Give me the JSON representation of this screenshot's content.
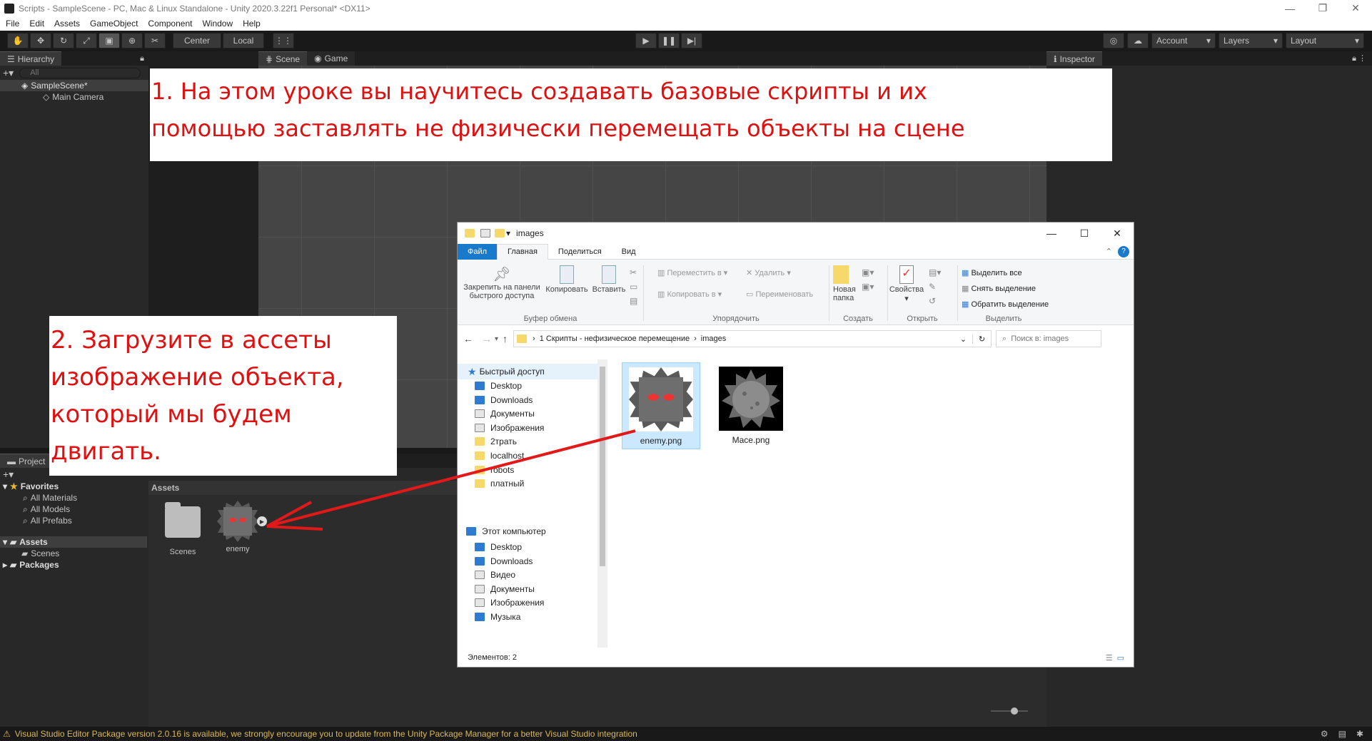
{
  "titlebar": {
    "title": "Scripts - SampleScene - PC, Mac & Linux Standalone - Unity 2020.3.22f1 Personal* <DX11>",
    "min": "—",
    "max": "❐",
    "close": "✕"
  },
  "menu": [
    "File",
    "Edit",
    "Assets",
    "GameObject",
    "Component",
    "Window",
    "Help"
  ],
  "toolbar": {
    "center": "Center",
    "local": "Local",
    "account": "Account",
    "layers": "Layers",
    "layout": "Layout"
  },
  "hierarchy": {
    "tab": "Hierarchy",
    "search_placeholder": "All",
    "scene": "SampleScene*",
    "camera": "Main Camera"
  },
  "scene_tabs": {
    "scene": "Scene",
    "game": "Game"
  },
  "inspector": {
    "tab": "Inspector"
  },
  "callout1": {
    "line1": "1. На этом уроке вы научитесь создавать базовые скрипты и их",
    "line2": "помощью заставлять не физически перемещать объекты на сцене"
  },
  "callout2": {
    "line1": "2. Загрузите в ассеты",
    "line2": "изображение объекта,",
    "line3": "который мы будем",
    "line4": "двигать."
  },
  "project": {
    "tab": "Project",
    "favorites": "Favorites",
    "fav_items": [
      "All Materials",
      "All Models",
      "All Prefabs"
    ],
    "assets": "Assets",
    "scenes": "Scenes",
    "packages": "Packages",
    "header": "Assets",
    "items": [
      {
        "label": "Scenes"
      },
      {
        "label": "enemy"
      }
    ]
  },
  "explorer": {
    "title": "images",
    "tabs": [
      "Файл",
      "Главная",
      "Поделиться",
      "Вид"
    ],
    "ribbon": {
      "pin": "Закрепить на панели быстрого доступа",
      "copy": "Копировать",
      "paste": "Вставить",
      "move_to": "Переместить в",
      "copy_to": "Копировать в",
      "delete": "Удалить",
      "rename": "Переименовать",
      "new_folder": "Новая папка",
      "properties": "Свойства",
      "select_all": "Выделить все",
      "select_none": "Снять выделение",
      "invert": "Обратить выделение",
      "groups": [
        "Буфер обмена",
        "Упорядочить",
        "Создать",
        "Открыть",
        "Выделить"
      ]
    },
    "path": [
      "1 Скрипты - нефизическое перемещение",
      "images"
    ],
    "search_placeholder": "Поиск в: images",
    "quick_access": "Быстрый доступ",
    "nav_quick": [
      {
        "label": "Desktop",
        "icon": "desktop-icon"
      },
      {
        "label": "Downloads",
        "icon": "download-icon"
      },
      {
        "label": "Документы",
        "icon": "documents-icon"
      },
      {
        "label": "Изображения",
        "icon": "pictures-icon"
      },
      {
        "label": "2трать",
        "icon": "folder-icon"
      },
      {
        "label": "localhost",
        "icon": "folder-icon"
      },
      {
        "label": "robots",
        "icon": "folder-icon"
      },
      {
        "label": "платный",
        "icon": "folder-icon"
      }
    ],
    "this_pc": "Этот компьютер",
    "nav_pc": [
      {
        "label": "Desktop",
        "icon": "desktop-icon"
      },
      {
        "label": "Downloads",
        "icon": "download-icon"
      },
      {
        "label": "Видео",
        "icon": "video-icon"
      },
      {
        "label": "Документы",
        "icon": "documents-icon"
      },
      {
        "label": "Изображения",
        "icon": "pictures-icon"
      },
      {
        "label": "Музыка",
        "icon": "music-icon"
      }
    ],
    "files": [
      "enemy.png",
      "Mace.png"
    ],
    "status": "Элементов: 2"
  },
  "statusbar": {
    "message": "Visual Studio Editor Package version 2.0.16 is available, we strongly encourage you to update from the Unity Package Manager for a better Visual Studio integration"
  }
}
